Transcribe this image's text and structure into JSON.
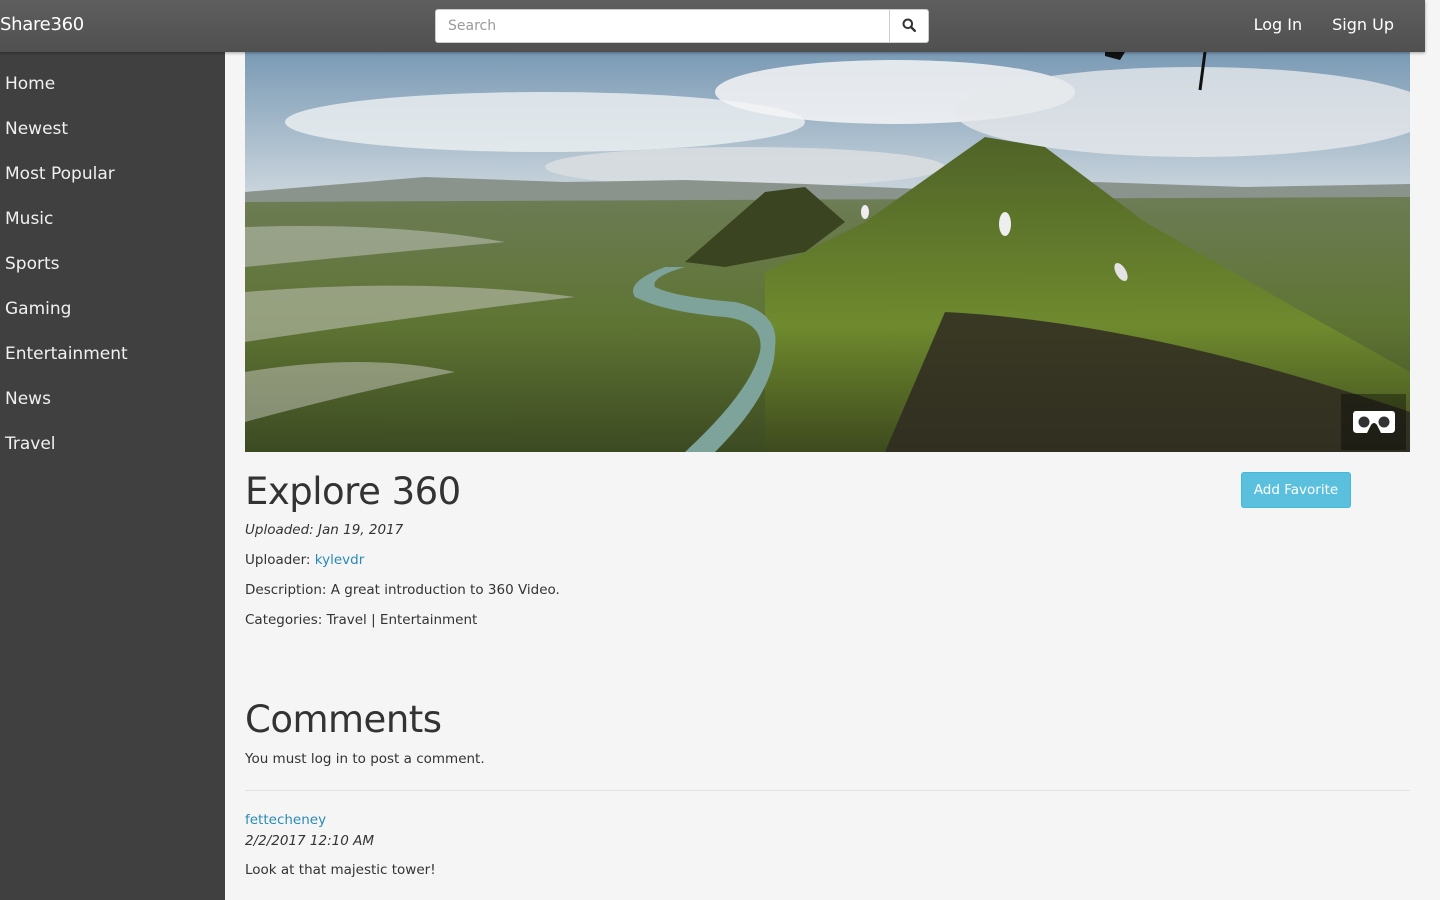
{
  "header": {
    "brand": "Share360",
    "search_placeholder": "Search",
    "login_label": "Log In",
    "signup_label": "Sign Up"
  },
  "sidebar": {
    "items": [
      {
        "label": "Home"
      },
      {
        "label": "Newest"
      },
      {
        "label": "Most Popular"
      },
      {
        "label": "Music"
      },
      {
        "label": "Sports"
      },
      {
        "label": "Gaming"
      },
      {
        "label": "Entertainment"
      },
      {
        "label": "News"
      },
      {
        "label": "Travel"
      }
    ]
  },
  "video": {
    "title": "Explore 360",
    "uploaded": "Uploaded: Jan 19, 2017",
    "uploader_label": "Uploader:",
    "uploader_name": "kylevdr",
    "description": "Description: A great introduction to 360 Video.",
    "categories_label": "Categories:",
    "categories": [
      "Travel",
      "Entertainment"
    ],
    "categories_separator": "|",
    "add_favorite_label": "Add Favorite",
    "vr_icon": "vr-cardboard-icon"
  },
  "comments": {
    "heading": "Comments",
    "login_note": "You must log in to post a comment.",
    "items": [
      {
        "user": "fettecheney",
        "time": "2/2/2017 12:10 AM",
        "text": "Look at that majestic tower!"
      }
    ]
  },
  "colors": {
    "topbar": "#585858",
    "sidebar": "#404040",
    "link": "#2a8ab5",
    "info_button": "#5bc0de",
    "background": "#f5f5f5"
  }
}
